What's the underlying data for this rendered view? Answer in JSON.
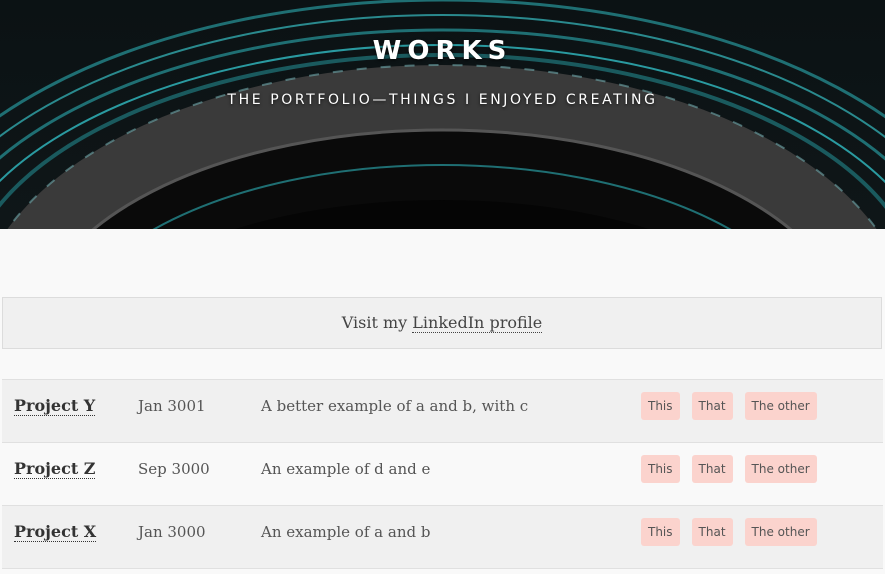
{
  "hero": {
    "title": "WORKS",
    "subtitle": "THE PORTFOLIO—THINGS I ENJOYED CREATING",
    "accent_color": "#2a9aa0"
  },
  "linkedin": {
    "prefix": "Visit my ",
    "link_text": "LinkedIn profile"
  },
  "projects": [
    {
      "name": "Project Y",
      "date": "Jan 3001",
      "description": "A better example of a and b, with c",
      "tags": [
        "This",
        "That",
        "The other"
      ]
    },
    {
      "name": "Project Z",
      "date": "Sep 3000",
      "description": "An example of d and e",
      "tags": [
        "This",
        "That",
        "The other"
      ]
    },
    {
      "name": "Project X",
      "date": "Jan 3000",
      "description": "An example of a and b",
      "tags": [
        "This",
        "That",
        "The other"
      ]
    }
  ],
  "colors": {
    "tag_background": "#fbd3cd",
    "page_background": "#f9f9f9",
    "row_shaded": "#f0f0f0"
  }
}
